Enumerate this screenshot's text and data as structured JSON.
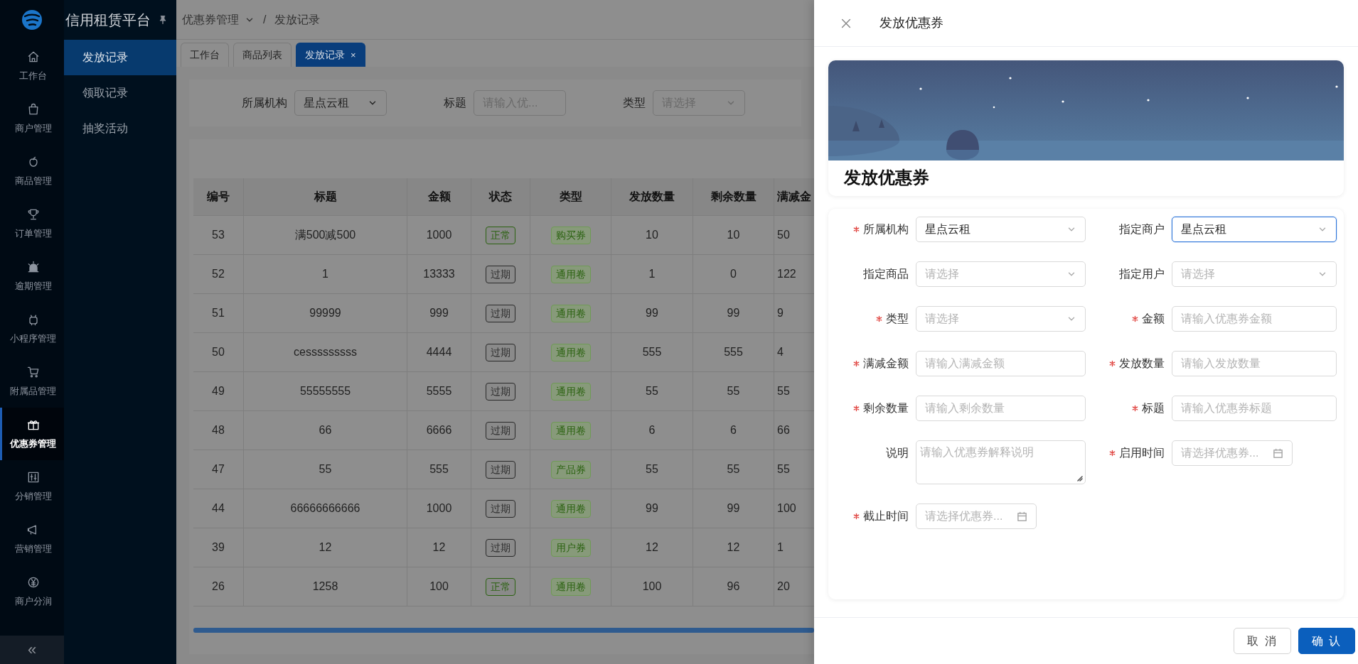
{
  "sidebar": {
    "title": "信用租赁平台",
    "items": [
      {
        "label": "工作台",
        "selected": false
      },
      {
        "label": "商户管理",
        "selected": false
      },
      {
        "label": "商品管理",
        "selected": false
      },
      {
        "label": "订单管理",
        "selected": false
      },
      {
        "label": "逾期管理",
        "selected": false
      },
      {
        "label": "小程序管理",
        "selected": false
      },
      {
        "label": "附属品管理",
        "selected": false
      },
      {
        "label": "优惠券管理",
        "selected": true
      },
      {
        "label": "分销管理",
        "selected": false
      },
      {
        "label": "营销管理",
        "selected": false
      },
      {
        "label": "商户分润",
        "selected": false
      }
    ],
    "collapse": "«",
    "submenu": [
      {
        "label": "发放记录",
        "selected": true
      },
      {
        "label": "领取记录",
        "selected": false
      },
      {
        "label": "抽奖活动",
        "selected": false
      }
    ]
  },
  "breadcrumb": {
    "parent": "优惠券管理",
    "separator": "/",
    "current": "发放记录"
  },
  "tabs": [
    {
      "label": "工作台",
      "selected": false
    },
    {
      "label": "商品列表",
      "selected": false
    },
    {
      "label": "发放记录",
      "selected": true,
      "close": "×"
    }
  ],
  "filters": [
    {
      "label": "所属机构",
      "kind": "select",
      "value": "星点云租"
    },
    {
      "label": "标题",
      "kind": "input",
      "placeholder": "请输入优..."
    },
    {
      "label": "类型",
      "kind": "select",
      "placeholder": "请选择"
    }
  ],
  "table": {
    "columns": [
      "编号",
      "标题",
      "金额",
      "状态",
      "类型",
      "发放数量",
      "剩余数量",
      "满减金"
    ],
    "rows": [
      {
        "id": "53",
        "title": "满500减500",
        "amount": "1000",
        "status": {
          "label": "正常",
          "color": "#2b6210"
        },
        "type": "购买券",
        "issued": "10",
        "remaining": "10",
        "column_8": "50"
      },
      {
        "id": "52",
        "title": "1",
        "amount": "13333",
        "status": {
          "label": "过期",
          "color": "#2a2a2a"
        },
        "type": "通用卷",
        "issued": "1",
        "remaining": "0",
        "column_8": "122"
      },
      {
        "id": "51",
        "title": "99999",
        "amount": "999",
        "status": {
          "label": "过期",
          "color": "#2a2a2a"
        },
        "type": "通用卷",
        "issued": "99",
        "remaining": "99",
        "column_8": "9"
      },
      {
        "id": "50",
        "title": "cesssssssss",
        "amount": "4444",
        "status": {
          "label": "过期",
          "color": "#2a2a2a"
        },
        "type": "通用卷",
        "issued": "555",
        "remaining": "555",
        "column_8": "4"
      },
      {
        "id": "49",
        "title": "55555555",
        "amount": "5555",
        "status": {
          "label": "过期",
          "color": "#2a2a2a"
        },
        "type": "通用卷",
        "issued": "55",
        "remaining": "55",
        "column_8": "55"
      },
      {
        "id": "48",
        "title": "66",
        "amount": "6666",
        "status": {
          "label": "过期",
          "color": "#2a2a2a"
        },
        "type": "通用卷",
        "issued": "6",
        "remaining": "6",
        "column_8": "66"
      },
      {
        "id": "47",
        "title": "55",
        "amount": "555",
        "status": {
          "label": "过期",
          "color": "#2a2a2a"
        },
        "type": "产品券",
        "issued": "55",
        "remaining": "55",
        "column_8": "55"
      },
      {
        "id": "44",
        "title": "66666666666",
        "amount": "1000",
        "status": {
          "label": "过期",
          "color": "#2a2a2a"
        },
        "type": "通用卷",
        "issued": "99",
        "remaining": "99",
        "column_8": "100"
      },
      {
        "id": "39",
        "title": "12",
        "amount": "12",
        "status": {
          "label": "过期",
          "color": "#2a2a2a"
        },
        "type": "用户券",
        "issued": "12",
        "remaining": "12",
        "column_8": "1"
      },
      {
        "id": "26",
        "title": "1258",
        "amount": "100",
        "status": {
          "label": "正常",
          "color": "#2b6210"
        },
        "type": "通用卷",
        "issued": "100",
        "remaining": "96",
        "column_8": "20"
      }
    ]
  },
  "drawer": {
    "title": "发放优惠券",
    "banner_title": "发放优惠券",
    "fields": [
      {
        "label": "所属机构",
        "required": true,
        "kind": "select",
        "value": "星点云租",
        "focused": false
      },
      {
        "label": "指定商户",
        "required": false,
        "kind": "select",
        "value": "星点云租",
        "focused": true
      },
      {
        "label": "指定商品",
        "required": false,
        "kind": "select",
        "placeholder": "请选择",
        "focused": false
      },
      {
        "label": "指定用户",
        "required": false,
        "kind": "select",
        "placeholder": "请选择",
        "focused": false
      },
      {
        "label": "类型",
        "required": true,
        "kind": "select",
        "placeholder": "请选择",
        "focused": false
      },
      {
        "label": "金额",
        "required": true,
        "kind": "input",
        "placeholder": "请输入优惠券金额",
        "focused": false
      },
      {
        "label": "满减金额",
        "required": true,
        "kind": "input",
        "placeholder": "请输入满减金额",
        "focused": false
      },
      {
        "label": "发放数量",
        "required": true,
        "kind": "input",
        "placeholder": "请输入发放数量",
        "focused": false
      },
      {
        "label": "剩余数量",
        "required": true,
        "kind": "input",
        "placeholder": "请输入剩余数量",
        "focused": false
      },
      {
        "label": "标题",
        "required": true,
        "kind": "input",
        "placeholder": "请输入优惠券标题",
        "focused": false
      },
      {
        "label": "说明",
        "required": false,
        "kind": "textarea",
        "placeholder": "请输入优惠券解释说明",
        "focused": false
      },
      {
        "label": "启用时间",
        "required": true,
        "kind": "date",
        "placeholder": "请选择优惠券...",
        "focused": false
      },
      {
        "label": "截止时间",
        "required": true,
        "kind": "date",
        "placeholder": "请选择优惠券...",
        "focused": false
      }
    ],
    "buttons": [
      {
        "label": "取 消",
        "kind": "default"
      },
      {
        "label": "确 认",
        "kind": "primary"
      }
    ]
  }
}
